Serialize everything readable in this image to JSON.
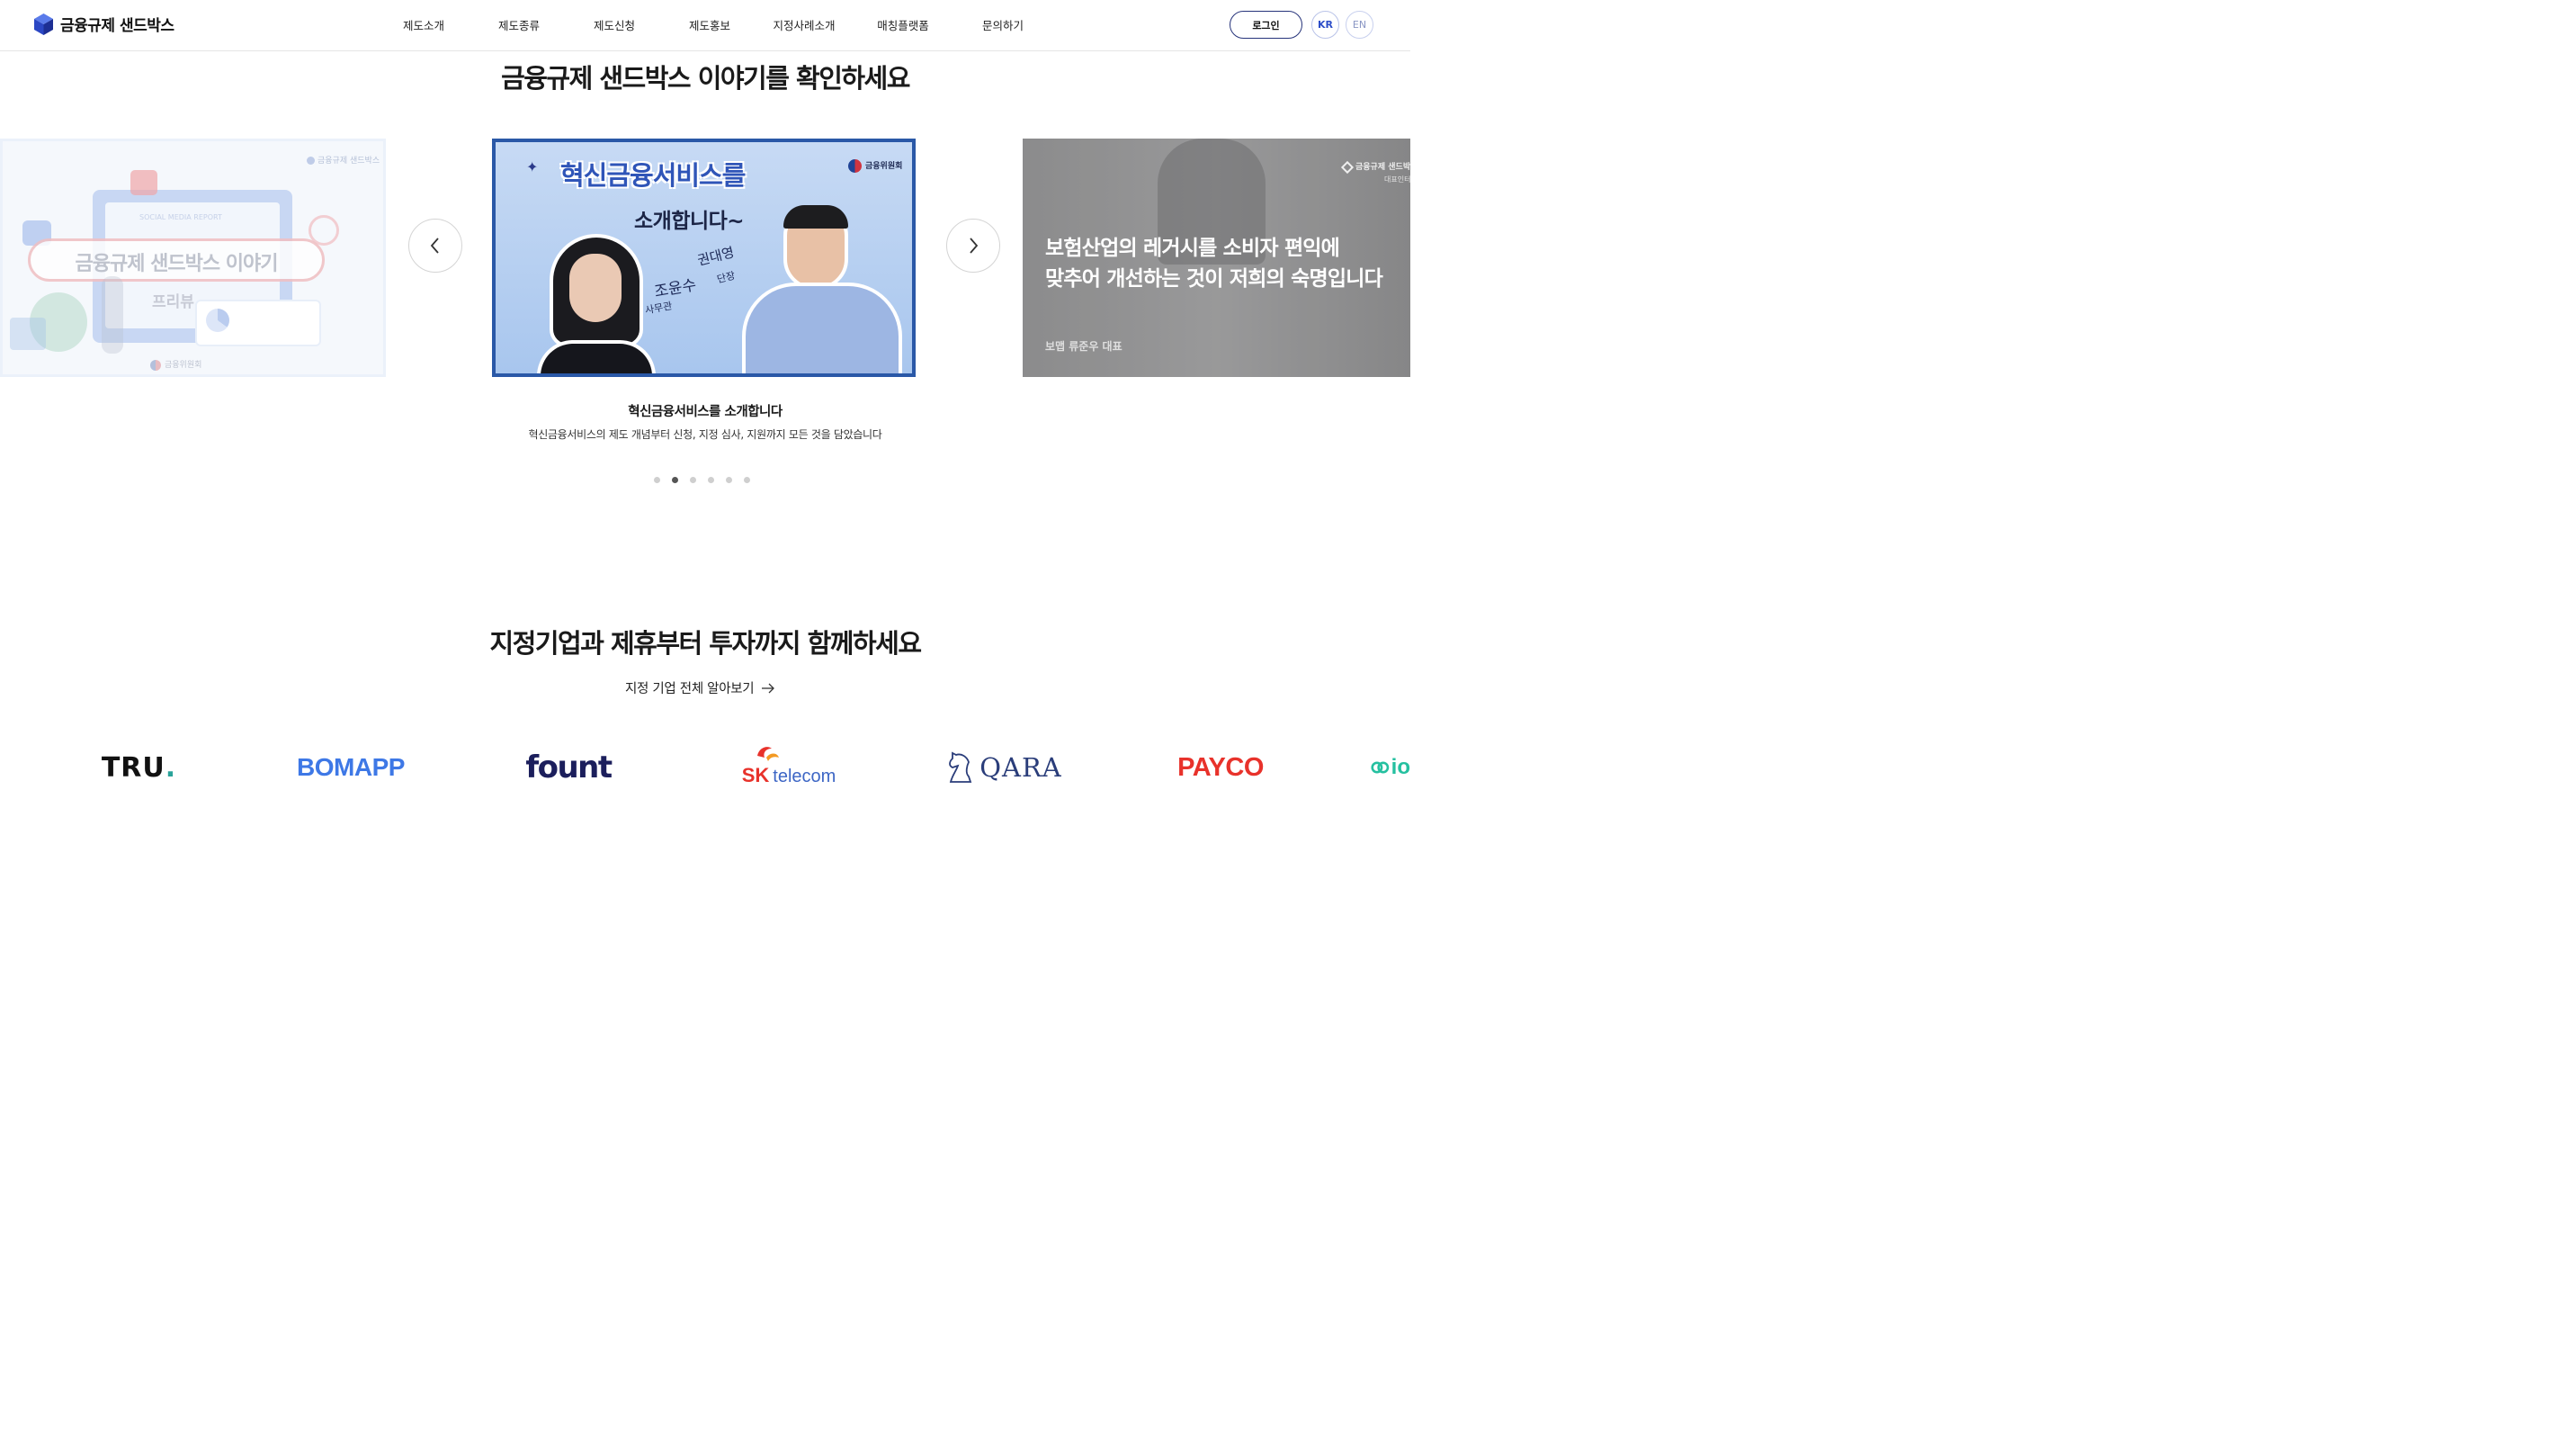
{
  "header": {
    "logo_text": "금융규제 샌드박스",
    "nav": [
      "제도소개",
      "제도종류",
      "제도신청",
      "제도홍보",
      "지정사례소개",
      "매칭플랫폼",
      "문의하기"
    ],
    "login_label": "로그인",
    "lang_kr": "KR",
    "lang_en": "EN"
  },
  "stories": {
    "title": "금융규제 샌드박스 이야기를 확인하세요",
    "slides": {
      "left": {
        "badge": "금융규제 샌드박스",
        "report_label": "SOCIAL MEDIA REPORT",
        "headline": "금융규제 샌드박스 이야기",
        "sub": "프리뷰",
        "footer_logo": "금융위원회"
      },
      "center": {
        "agency": "금융위원회",
        "headline_1": "혁신금융서비스를",
        "headline_2": "소개합니다~",
        "person_a_name": "조윤수",
        "person_a_title": "사무관",
        "person_b_name": "권대영",
        "person_b_title": "단장"
      },
      "right": {
        "badge": "금융규제 샌드박",
        "badge_sub": "대표인터",
        "quote_1": "보험산업의 레거시를 소비자 편익에",
        "quote_2": "맞추어 개선하는 것이 저희의 숙명입니다",
        "speaker": "보맵 류준우 대표"
      }
    },
    "caption_title": "혁신금융서비스를 소개합니다",
    "caption_desc": "혁신금융서비스의 제도 개념부터 신청, 지정 심사, 지원까지 모든 것을 담았습니다",
    "dots_total": 6,
    "dots_active": 2
  },
  "partners_section": {
    "title": "지정기업과 제휴부터 투자까지 함께하세요",
    "link_label": "지정 기업 전체 알아보기",
    "logos": {
      "tru": "TRU",
      "bomapp": "BOMAPP",
      "fount": "fount",
      "sk_a": "SK",
      "sk_b": "telecom",
      "qara": "QARA",
      "payco": "PAYCO",
      "partial": "io"
    }
  },
  "colors": {
    "brand_navy": "#26337a",
    "brand_blue": "#2d4ec8",
    "slide_border": "#2a58a7",
    "payco_red": "#e8322b",
    "bomapp_blue": "#3e78e6",
    "fount_navy": "#1c1f5c",
    "sk_red": "#e8322b",
    "sk_blue": "#3d66c5"
  }
}
